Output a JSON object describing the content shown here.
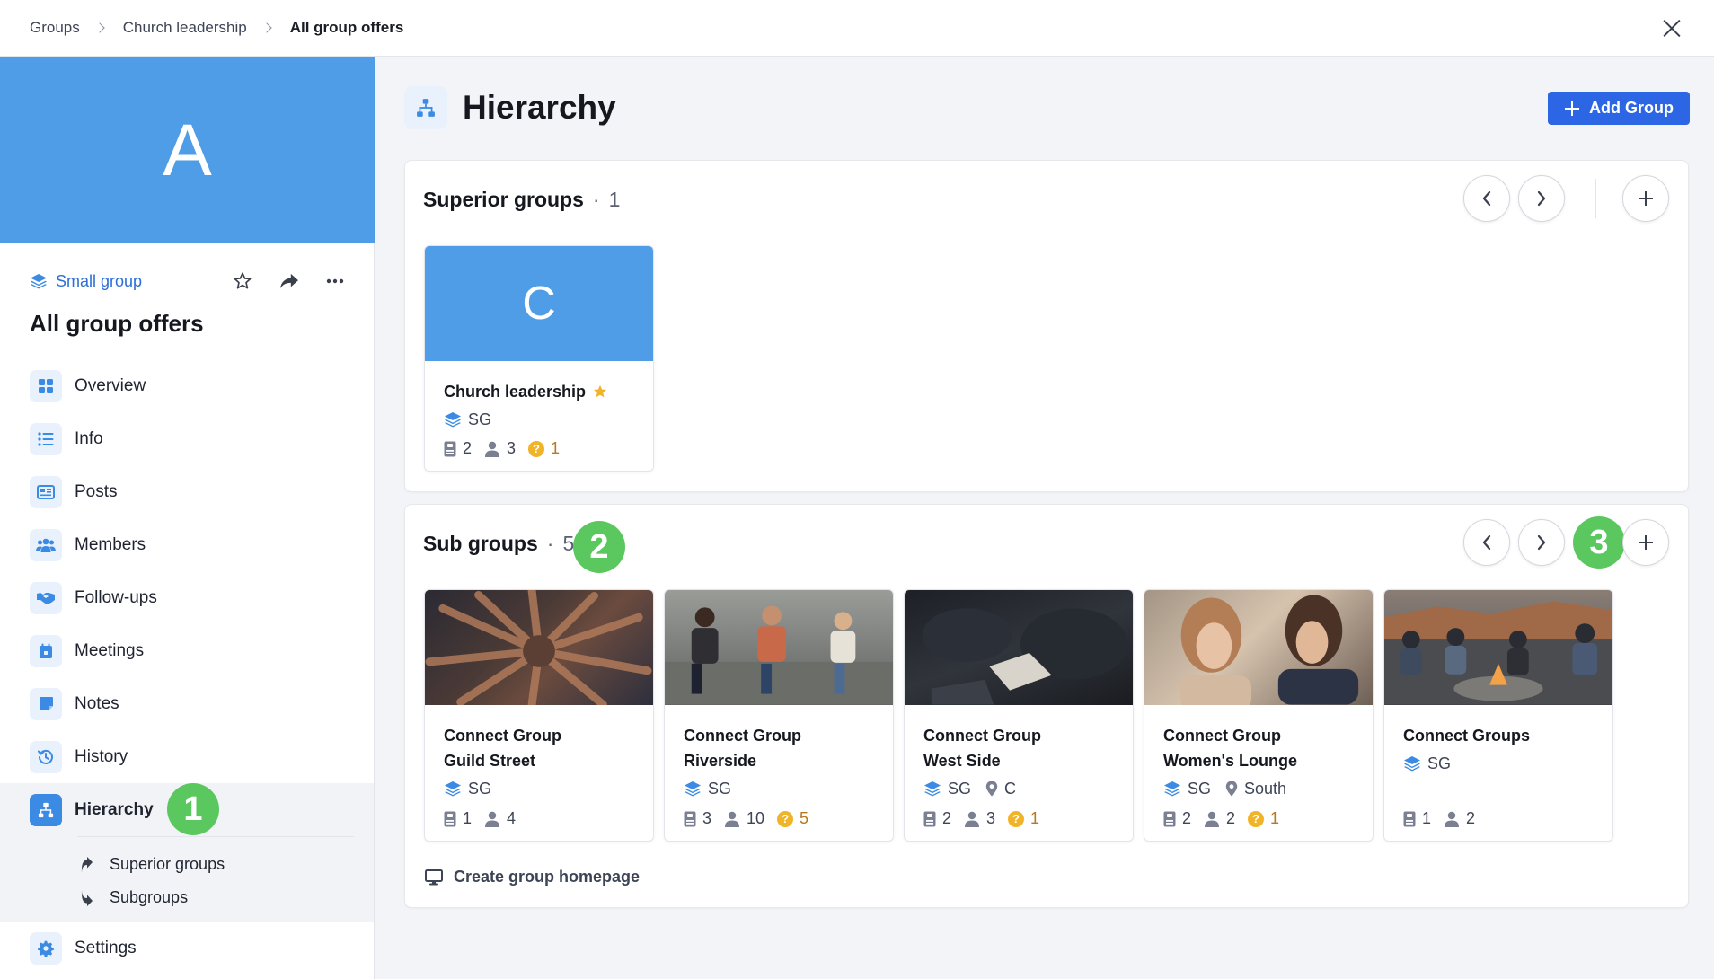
{
  "breadcrumb": [
    "Groups",
    "Church leadership",
    "All group offers"
  ],
  "sidebar": {
    "avatar_letter": "A",
    "group_type": "Small group",
    "group_title": "All group offers",
    "nav": [
      {
        "label": "Overview",
        "icon": "grid-icon"
      },
      {
        "label": "Info",
        "icon": "list-icon"
      },
      {
        "label": "Posts",
        "icon": "newspaper-icon"
      },
      {
        "label": "Members",
        "icon": "users-icon"
      },
      {
        "label": "Follow-ups",
        "icon": "handshake-icon"
      },
      {
        "label": "Meetings",
        "icon": "calendar-icon"
      },
      {
        "label": "Notes",
        "icon": "note-icon"
      },
      {
        "label": "History",
        "icon": "history-icon"
      }
    ],
    "active": {
      "label": "Hierarchy",
      "icon": "hierarchy-icon"
    },
    "sub_items": [
      "Superior groups",
      "Subgroups"
    ],
    "settings": "Settings"
  },
  "main": {
    "title": "Hierarchy",
    "add_button": "Add Group",
    "superior": {
      "title": "Superior groups",
      "count": "1",
      "cards": [
        {
          "letter": "C",
          "name": "Church leadership",
          "type": "SG",
          "favorite": true,
          "stats": {
            "a": "2",
            "b": "3",
            "c": "1"
          }
        }
      ]
    },
    "sub": {
      "title": "Sub groups",
      "count": "5",
      "cards": [
        {
          "name1": "Connect Group",
          "name2": "Guild Street",
          "type": "SG",
          "location": "",
          "stats": {
            "a": "1",
            "b": "4",
            "c": ""
          }
        },
        {
          "name1": "Connect Group",
          "name2": "Riverside",
          "type": "SG",
          "location": "",
          "stats": {
            "a": "3",
            "b": "10",
            "c": "5"
          }
        },
        {
          "name1": "Connect Group",
          "name2": "West Side",
          "type": "SG",
          "location": "C",
          "stats": {
            "a": "2",
            "b": "3",
            "c": "1"
          }
        },
        {
          "name1": "Connect Group",
          "name2": "Women's Lounge",
          "type": "SG",
          "location": "South",
          "stats": {
            "a": "2",
            "b": "2",
            "c": "1"
          }
        },
        {
          "name1": "Connect Groups",
          "name2": "",
          "type": "SG",
          "location": "",
          "stats": {
            "a": "1",
            "b": "2",
            "c": ""
          }
        }
      ]
    },
    "create_link": "Create group homepage"
  },
  "markers": [
    "1",
    "2",
    "3"
  ],
  "colors": {
    "accent": "#2d66e4",
    "banner": "#4e9de6",
    "marker": "#5bc85f",
    "question": "#f0b429"
  }
}
